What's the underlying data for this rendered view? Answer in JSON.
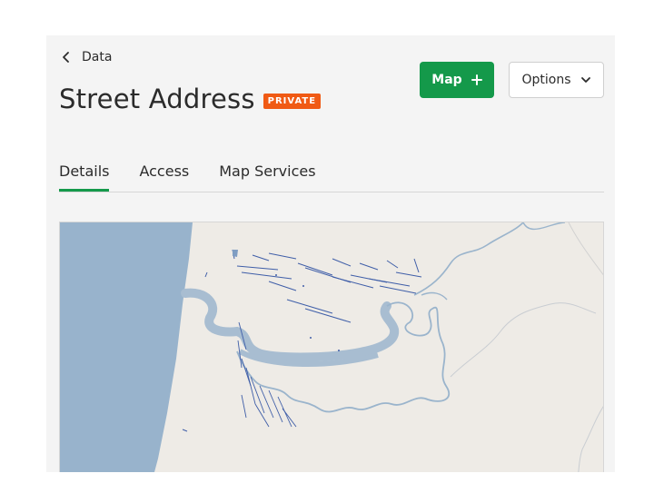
{
  "nav": {
    "back_label": "Data"
  },
  "header": {
    "title": "Street Address",
    "badge": "PRIVATE"
  },
  "actions": {
    "map_label": "Map",
    "options_label": "Options"
  },
  "tabs": [
    {
      "label": "Details",
      "active": true
    },
    {
      "label": "Access",
      "active": false
    },
    {
      "label": "Map Services",
      "active": false
    }
  ],
  "colors": {
    "accent_green": "#14994a",
    "badge_orange": "#f05a14",
    "water": "#98b3cc",
    "land": "#eeebe6",
    "river_line": "#9ab4cc",
    "feature_lines": "#3f5ea8"
  }
}
